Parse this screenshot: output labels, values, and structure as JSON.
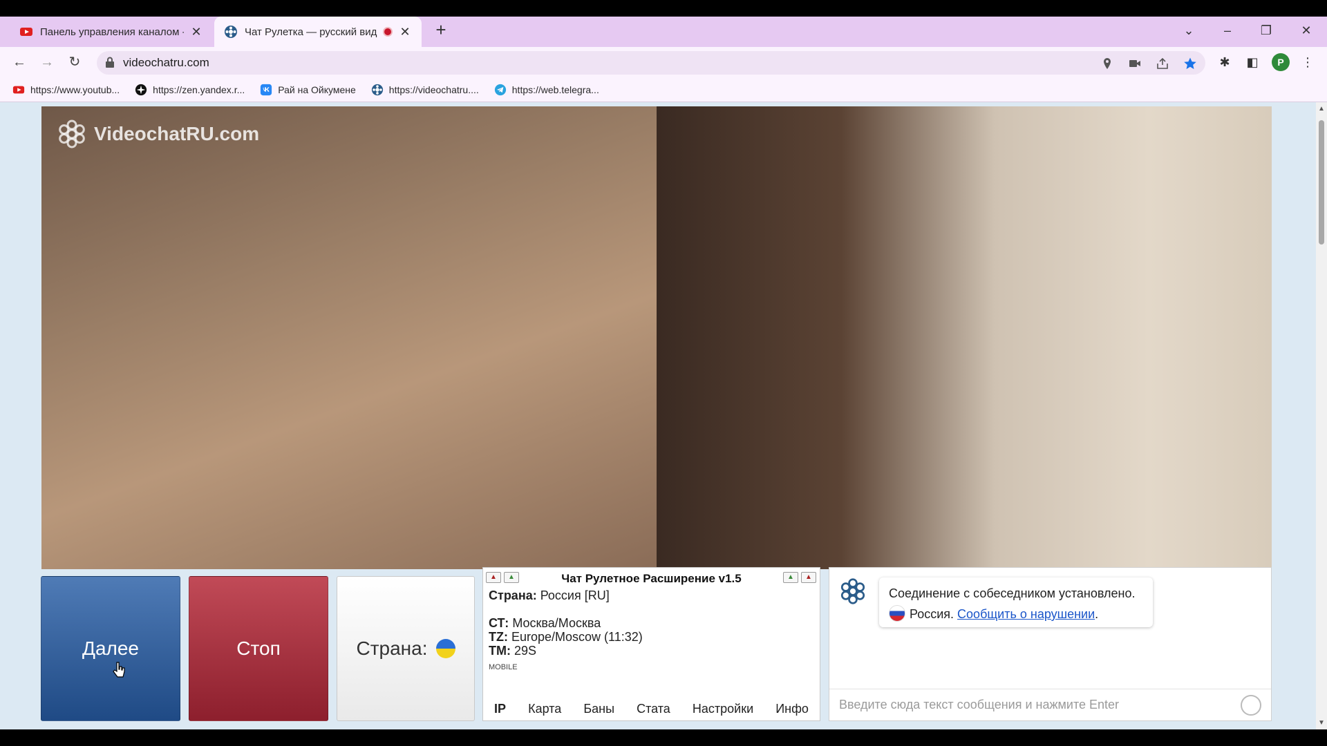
{
  "browser": {
    "tabs": [
      {
        "title": "Панель управления каналом - Y"
      },
      {
        "title": "Чат Рулетка — русский вид"
      }
    ],
    "url": "videochatru.com",
    "profile_initial": "P"
  },
  "bookmarks": [
    {
      "label": "https://www.youtub...",
      "icon": "youtube-icon"
    },
    {
      "label": "https://zen.yandex.r...",
      "icon": "zen-icon"
    },
    {
      "label": "Рай на Ойкумене",
      "icon": "vk-icon"
    },
    {
      "label": "https://videochatru....",
      "icon": "videochat-icon"
    },
    {
      "label": "https://web.telegra...",
      "icon": "telegram-icon"
    }
  ],
  "page": {
    "logo_text": "VideochatRU.com",
    "buttons": {
      "next": "Далее",
      "stop": "Стоп",
      "country": "Страна:"
    },
    "extension": {
      "title": "Чат Рулетное Расширение v1.5",
      "country_label": "Страна:",
      "country_value": " Россия [RU]",
      "city_label": "СТ:",
      "city_value": " Москва/Москва",
      "tz_label": "TZ:",
      "tz_value": " Europe/Moscow (11:32)",
      "tm_label": "TM:",
      "tm_value": " 29S",
      "device": "MOBILE",
      "tabs": [
        "IP",
        "Карта",
        "Баны",
        "Стата",
        "Настройки",
        "Инфо"
      ]
    },
    "chat": {
      "message": "Соединение с собеседником установлено.",
      "country": "Россия.",
      "report_link": "Сообщить о нарушении",
      "period": ".",
      "input_placeholder": "Введите сюда текст сообщения и нажмите Enter"
    }
  },
  "colors": {
    "tabstrip": "#e6c9f2",
    "toolbar": "#fbf3fe",
    "page_bg": "#dce9f3",
    "next_button": "#2f5c9a",
    "stop_button": "#a93443",
    "link": "#1a55c9"
  }
}
